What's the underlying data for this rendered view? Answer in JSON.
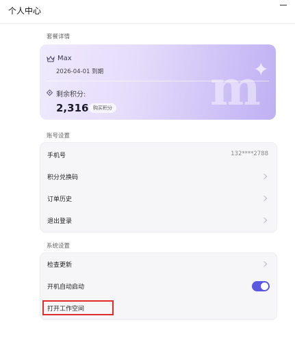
{
  "window": {
    "title": "个人中心"
  },
  "plan_section": {
    "label": "套餐详情",
    "card": {
      "plan_name": "Max",
      "expiry": "2026-04-01 到期",
      "credits_label": "剩余积分:",
      "credits_value": "2,316",
      "buy_button": "购买积分",
      "watermark": "m"
    }
  },
  "account_section": {
    "label": "账号设置",
    "items": [
      {
        "label": "手机号",
        "value": "132****2788"
      },
      {
        "label": "积分兑换码"
      },
      {
        "label": "订单历史"
      },
      {
        "label": "退出登录"
      }
    ]
  },
  "system_section": {
    "label": "系统设置",
    "items": [
      {
        "label": "检查更新"
      },
      {
        "label": "开机自动启动",
        "toggle_on": true
      },
      {
        "label": "打开工作空间"
      }
    ]
  },
  "colors": {
    "accent": "#5b57e3",
    "highlight": "#e02b2b"
  },
  "icons": {
    "plan": "crown-icon",
    "credits": "diamond-icon",
    "row_arrow": "chevron-right-icon"
  }
}
